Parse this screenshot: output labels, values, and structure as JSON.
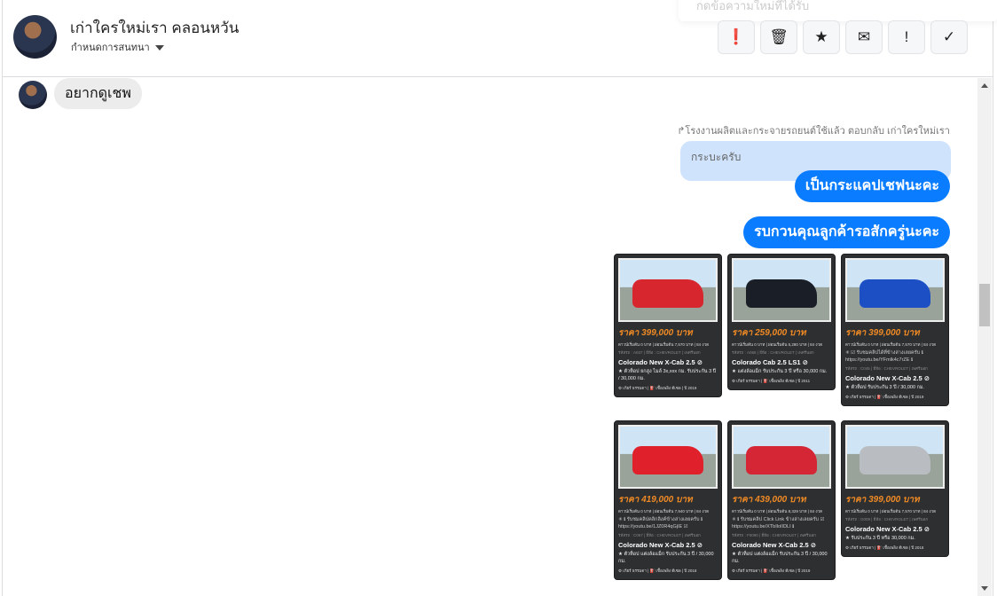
{
  "header": {
    "title": "เก่าใครใหม่เรา คลอนหวัน",
    "subtitle": "กำหนดการสนทนา",
    "toast": "กดข้อความใหม่ที่ได้รับ",
    "actions": [
      {
        "name": "spam",
        "glyph": "❗"
      },
      {
        "name": "delete",
        "glyph": "🗑"
      },
      {
        "name": "star",
        "glyph": "★"
      },
      {
        "name": "mark-unread",
        "glyph": "✉"
      },
      {
        "name": "important",
        "glyph": "!"
      },
      {
        "name": "done",
        "glyph": "✓"
      }
    ]
  },
  "messages": {
    "incoming": "อยากดูเชพ",
    "reply_meta": "↱โรงงานผลิตและกระจายรถยนต์ใช้แล้ว ตอบกลับ เก่าใครใหม่เรา",
    "quoted": "กระบะครับ",
    "out1": "เป็นกระแคปเชฟนะคะ",
    "out2": "รบกวนคุณลูกค้ารอสักครู่นะคะ"
  },
  "cards": [
    {
      "price": "ราคา 399,000 บาท",
      "info": "ดาวน์เริ่มต้น 0 บาท | ผ่อนเริ่มต้น 7,570 บาท | 84 งวด",
      "link": "",
      "tag": "รหัสรถ : A037 | ยี่ห้อ : CHEVROLET | เพศรีนอก",
      "title": "Colorado New X-Cab 2.5 ⊘",
      "desc": "★ ตัวท็อป ยกสูง ไมล์ 3x,xxx กม. รับประกัน 3 ปี / 30,000 กม.",
      "foot": "⚙ เกียร์ ธรรมดา | ⛽ เชื้อเพลิง ดีเซล | ปี 2019",
      "color": "#d8262e"
    },
    {
      "price": "ราคา 259,000 บาท",
      "info": "ดาวน์เริ่มต้น 0 บาท | ผ่อนเริ่มต้น 5,280 บาท | 84 งวด",
      "link": "",
      "tag": "รหัสรถ : A085 | ยี่ห้อ : CHEVROLET | เพศรีนอก",
      "title": "Colorado Cab 2.5 LS1 ⊘",
      "desc": "★ แต่งล้อแม็ก รับประกัน 3 ปี หรือ 30,000 กม.",
      "foot": "⚙ เกียร์ ธรรมดา | ⛽ เชื้อเพลิง ดีเซล | ปี 2011",
      "color": "#1a1e26"
    },
    {
      "price": "ราคา 399,000 บาท",
      "info": "ดาวน์เริ่มต้น 0 บาท | ผ่อนเริ่มต้น 7,570 บาท | 84 งวด",
      "link": "✳ ☑ รับชมคลิปได้ที่ข้างล่างเลยครับ ℹ https://youtu.be/YFmlk4c7rZE ℹ",
      "tag": "รหัสรถ : C045 | ยี่ห้อ : CHEVROLET | เพศรีนอก",
      "title": "Colorado New X-Cab 2.5 ⊘",
      "desc": "★ ตัวท็อป รับประกัน 3 ปี / 30,000 กม.",
      "foot": "⚙ เกียร์ ธรรมดา | ⛽ เชื้อเพลิง ดีเซล | ปี 2019",
      "color": "#1c4fc4"
    },
    {
      "price": "ราคา 419,000 บาท",
      "info": "ดาวน์เริ่มต้น 0 บาท | ผ่อนเริ่มต้น 7,940 บาท | 84 งวด",
      "link": "✳ ℹ รับชมคลิปคลิกลิงค์ข้างล่างเลยครับ ℹ https://youtu.be/1JZ0R4qGjIE ☑",
      "tag": "รหัสรถ : C067 | ยี่ห้อ : CHEVROLET | เพศรีนอก",
      "title": "Colorado New X-Cab 2.5 ⊘",
      "desc": "★ ตัวท็อป แต่งล้อแม็ก รับประกัน 3 ปี / 30,000 กม.",
      "foot": "⚙ เกียร์ ธรรมดา | ⛽ เชื้อเพลิง ดีเซล | ปี 2018",
      "color": "#e0212b"
    },
    {
      "price": "ราคา 439,000 บาท",
      "info": "ดาวน์เริ่มต้น 0 บาท | ผ่อนเริ่มต้น 8,329 บาท | 84 งวด",
      "link": "✳ ℹ รับชมคลิป Click Link ข้างล่างเลยครับ ☑ https://youtu.be/XTbIloIIDLI ℹ",
      "tag": "รหัสรถ : F0090 | ยี่ห้อ : CHEVROLET | เพศรีนอก",
      "title": "Colorado New X-Cab 2.5 ⊘",
      "desc": "★ ตัวท็อป แต่งล้อแม็ก รับประกัน 3 ปี / 30,000 กม.",
      "foot": "⚙ เกียร์ ธรรมดา | ⛽ เชื้อเพลิง ดีเซล | ปี 2019",
      "color": "#d42634"
    },
    {
      "price": "ราคา 399,000 บาท",
      "info": "ดาวน์เริ่มต้น 0 บาท | ผ่อนเริ่มต้น 7,570 บาท | 84 งวด",
      "link": "",
      "tag": "รหัสรถ : G009 | ยี่ห้อ : CHEVROLET | เพศรีนอก",
      "title": "Colorado New X-Cab 2.5 ⊘",
      "desc": "★ รับประกัน 3 ปี หรือ 30,000 กม.",
      "foot": "⚙ เกียร์ ธรรมดา | ⛽ เชื้อเพลิง ดีเซล | ปี 2018",
      "color": "#b9bcc0"
    }
  ]
}
